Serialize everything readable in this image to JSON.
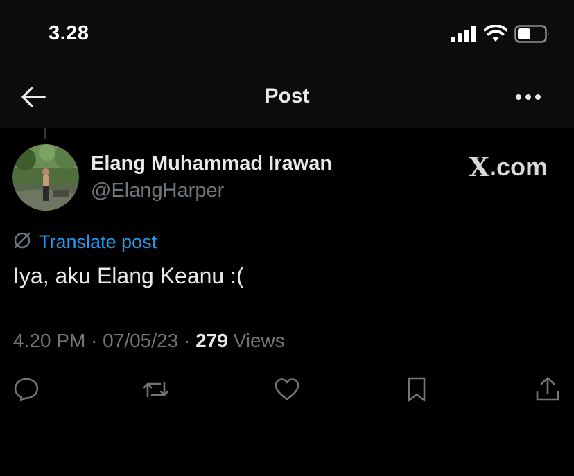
{
  "status_bar": {
    "time": "3.28",
    "icons": [
      "signal-icon",
      "wifi-icon",
      "battery-icon"
    ]
  },
  "header": {
    "title": "Post",
    "back_icon": "arrow-left-icon",
    "more_icon": "more-horizontal-icon"
  },
  "post": {
    "author_name": "Elang Muhammad Irawan",
    "author_handle": "@ElangHarper",
    "translate_label": "Translate post",
    "text": "Iya, aku Elang Keanu :(",
    "time": "4.20 PM",
    "date": "07/05/23",
    "views_count": "279",
    "views_label": "Views"
  },
  "watermark": {
    "logo_letter": "X",
    "suffix": ".com"
  },
  "actions": [
    {
      "icon": "reply-icon"
    },
    {
      "icon": "repost-icon"
    },
    {
      "icon": "like-icon"
    },
    {
      "icon": "bookmark-icon"
    },
    {
      "icon": "share-icon"
    }
  ],
  "colors": {
    "background": "#000000",
    "text_primary": "#e7e9ea",
    "text_secondary": "#71767b",
    "link_blue": "#1d9bf0"
  }
}
